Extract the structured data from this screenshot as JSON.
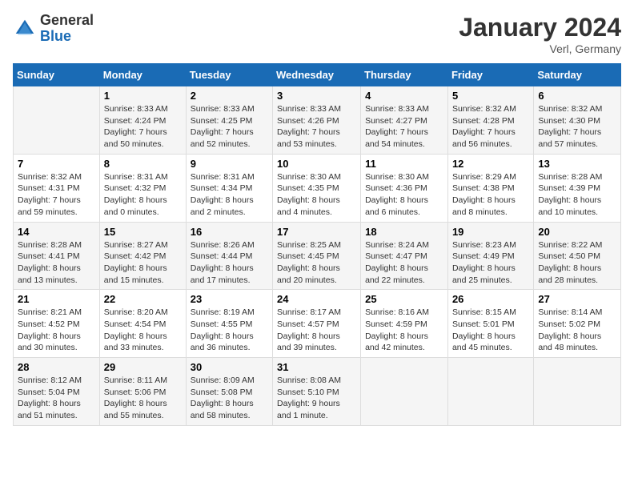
{
  "logo": {
    "text_general": "General",
    "text_blue": "Blue"
  },
  "header": {
    "month_title": "January 2024",
    "location": "Verl, Germany"
  },
  "days_of_week": [
    "Sunday",
    "Monday",
    "Tuesday",
    "Wednesday",
    "Thursday",
    "Friday",
    "Saturday"
  ],
  "weeks": [
    [
      {
        "day": "",
        "sunrise": "",
        "sunset": "",
        "daylight": ""
      },
      {
        "day": "1",
        "sunrise": "Sunrise: 8:33 AM",
        "sunset": "Sunset: 4:24 PM",
        "daylight": "Daylight: 7 hours and 50 minutes."
      },
      {
        "day": "2",
        "sunrise": "Sunrise: 8:33 AM",
        "sunset": "Sunset: 4:25 PM",
        "daylight": "Daylight: 7 hours and 52 minutes."
      },
      {
        "day": "3",
        "sunrise": "Sunrise: 8:33 AM",
        "sunset": "Sunset: 4:26 PM",
        "daylight": "Daylight: 7 hours and 53 minutes."
      },
      {
        "day": "4",
        "sunrise": "Sunrise: 8:33 AM",
        "sunset": "Sunset: 4:27 PM",
        "daylight": "Daylight: 7 hours and 54 minutes."
      },
      {
        "day": "5",
        "sunrise": "Sunrise: 8:32 AM",
        "sunset": "Sunset: 4:28 PM",
        "daylight": "Daylight: 7 hours and 56 minutes."
      },
      {
        "day": "6",
        "sunrise": "Sunrise: 8:32 AM",
        "sunset": "Sunset: 4:30 PM",
        "daylight": "Daylight: 7 hours and 57 minutes."
      }
    ],
    [
      {
        "day": "7",
        "sunrise": "Sunrise: 8:32 AM",
        "sunset": "Sunset: 4:31 PM",
        "daylight": "Daylight: 7 hours and 59 minutes."
      },
      {
        "day": "8",
        "sunrise": "Sunrise: 8:31 AM",
        "sunset": "Sunset: 4:32 PM",
        "daylight": "Daylight: 8 hours and 0 minutes."
      },
      {
        "day": "9",
        "sunrise": "Sunrise: 8:31 AM",
        "sunset": "Sunset: 4:34 PM",
        "daylight": "Daylight: 8 hours and 2 minutes."
      },
      {
        "day": "10",
        "sunrise": "Sunrise: 8:30 AM",
        "sunset": "Sunset: 4:35 PM",
        "daylight": "Daylight: 8 hours and 4 minutes."
      },
      {
        "day": "11",
        "sunrise": "Sunrise: 8:30 AM",
        "sunset": "Sunset: 4:36 PM",
        "daylight": "Daylight: 8 hours and 6 minutes."
      },
      {
        "day": "12",
        "sunrise": "Sunrise: 8:29 AM",
        "sunset": "Sunset: 4:38 PM",
        "daylight": "Daylight: 8 hours and 8 minutes."
      },
      {
        "day": "13",
        "sunrise": "Sunrise: 8:28 AM",
        "sunset": "Sunset: 4:39 PM",
        "daylight": "Daylight: 8 hours and 10 minutes."
      }
    ],
    [
      {
        "day": "14",
        "sunrise": "Sunrise: 8:28 AM",
        "sunset": "Sunset: 4:41 PM",
        "daylight": "Daylight: 8 hours and 13 minutes."
      },
      {
        "day": "15",
        "sunrise": "Sunrise: 8:27 AM",
        "sunset": "Sunset: 4:42 PM",
        "daylight": "Daylight: 8 hours and 15 minutes."
      },
      {
        "day": "16",
        "sunrise": "Sunrise: 8:26 AM",
        "sunset": "Sunset: 4:44 PM",
        "daylight": "Daylight: 8 hours and 17 minutes."
      },
      {
        "day": "17",
        "sunrise": "Sunrise: 8:25 AM",
        "sunset": "Sunset: 4:45 PM",
        "daylight": "Daylight: 8 hours and 20 minutes."
      },
      {
        "day": "18",
        "sunrise": "Sunrise: 8:24 AM",
        "sunset": "Sunset: 4:47 PM",
        "daylight": "Daylight: 8 hours and 22 minutes."
      },
      {
        "day": "19",
        "sunrise": "Sunrise: 8:23 AM",
        "sunset": "Sunset: 4:49 PM",
        "daylight": "Daylight: 8 hours and 25 minutes."
      },
      {
        "day": "20",
        "sunrise": "Sunrise: 8:22 AM",
        "sunset": "Sunset: 4:50 PM",
        "daylight": "Daylight: 8 hours and 28 minutes."
      }
    ],
    [
      {
        "day": "21",
        "sunrise": "Sunrise: 8:21 AM",
        "sunset": "Sunset: 4:52 PM",
        "daylight": "Daylight: 8 hours and 30 minutes."
      },
      {
        "day": "22",
        "sunrise": "Sunrise: 8:20 AM",
        "sunset": "Sunset: 4:54 PM",
        "daylight": "Daylight: 8 hours and 33 minutes."
      },
      {
        "day": "23",
        "sunrise": "Sunrise: 8:19 AM",
        "sunset": "Sunset: 4:55 PM",
        "daylight": "Daylight: 8 hours and 36 minutes."
      },
      {
        "day": "24",
        "sunrise": "Sunrise: 8:17 AM",
        "sunset": "Sunset: 4:57 PM",
        "daylight": "Daylight: 8 hours and 39 minutes."
      },
      {
        "day": "25",
        "sunrise": "Sunrise: 8:16 AM",
        "sunset": "Sunset: 4:59 PM",
        "daylight": "Daylight: 8 hours and 42 minutes."
      },
      {
        "day": "26",
        "sunrise": "Sunrise: 8:15 AM",
        "sunset": "Sunset: 5:01 PM",
        "daylight": "Daylight: 8 hours and 45 minutes."
      },
      {
        "day": "27",
        "sunrise": "Sunrise: 8:14 AM",
        "sunset": "Sunset: 5:02 PM",
        "daylight": "Daylight: 8 hours and 48 minutes."
      }
    ],
    [
      {
        "day": "28",
        "sunrise": "Sunrise: 8:12 AM",
        "sunset": "Sunset: 5:04 PM",
        "daylight": "Daylight: 8 hours and 51 minutes."
      },
      {
        "day": "29",
        "sunrise": "Sunrise: 8:11 AM",
        "sunset": "Sunset: 5:06 PM",
        "daylight": "Daylight: 8 hours and 55 minutes."
      },
      {
        "day": "30",
        "sunrise": "Sunrise: 8:09 AM",
        "sunset": "Sunset: 5:08 PM",
        "daylight": "Daylight: 8 hours and 58 minutes."
      },
      {
        "day": "31",
        "sunrise": "Sunrise: 8:08 AM",
        "sunset": "Sunset: 5:10 PM",
        "daylight": "Daylight: 9 hours and 1 minute."
      },
      {
        "day": "",
        "sunrise": "",
        "sunset": "",
        "daylight": ""
      },
      {
        "day": "",
        "sunrise": "",
        "sunset": "",
        "daylight": ""
      },
      {
        "day": "",
        "sunrise": "",
        "sunset": "",
        "daylight": ""
      }
    ]
  ]
}
